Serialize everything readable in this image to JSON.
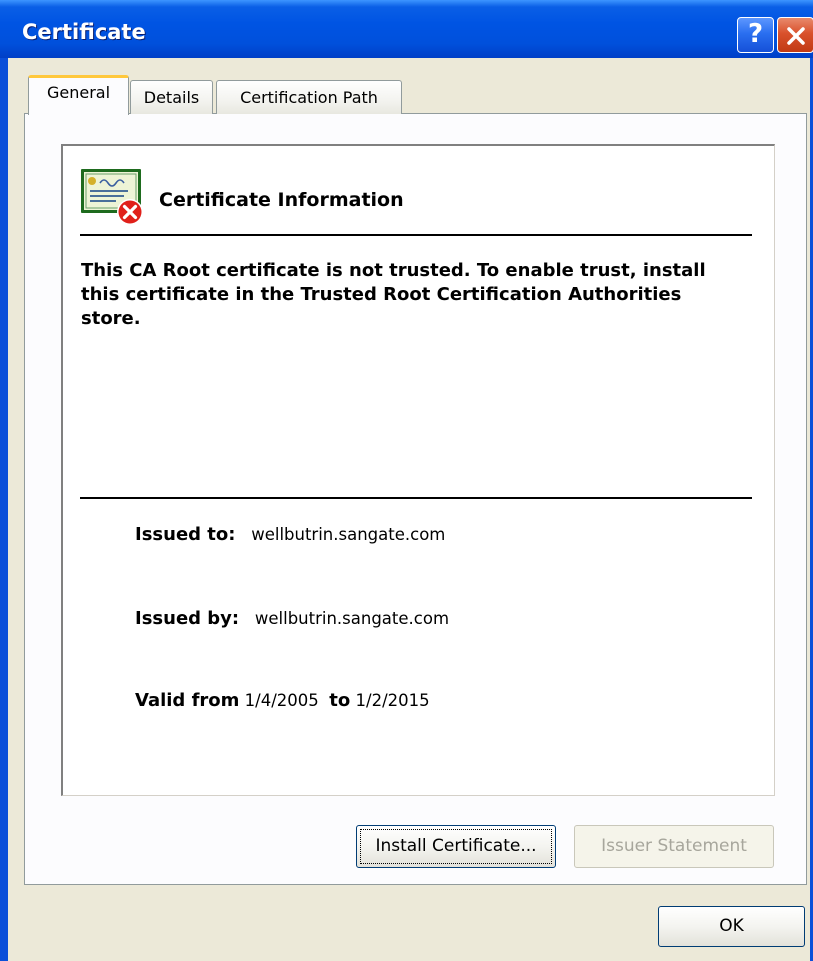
{
  "window": {
    "title": "Certificate",
    "help_label": "?"
  },
  "tabs": [
    {
      "label": "General"
    },
    {
      "label": "Details"
    },
    {
      "label": "Certification Path"
    }
  ],
  "general": {
    "heading": "Certificate Information",
    "status_message": "This CA Root certificate is not trusted. To enable trust, install this certificate in the Trusted Root Certification Authorities store.",
    "issued_to_label": "Issued to:",
    "issued_to_value": "wellbutrin.sangate.com",
    "issued_by_label": "Issued by:",
    "issued_by_value": "wellbutrin.sangate.com",
    "valid_from_label": "Valid from",
    "valid_from_value": "1/4/2005",
    "valid_to_label": "to",
    "valid_to_value": "1/2/2015"
  },
  "buttons": {
    "install": "Install Certificate...",
    "issuer_statement": "Issuer Statement",
    "ok": "OK"
  },
  "icons": {
    "certificate": "certificate-error-icon",
    "help": "help-icon",
    "close": "close-icon"
  },
  "colors": {
    "titlebar": "#0054e3",
    "active_tab_highlight": "#ffc83c",
    "error_red": "#e0201a"
  }
}
